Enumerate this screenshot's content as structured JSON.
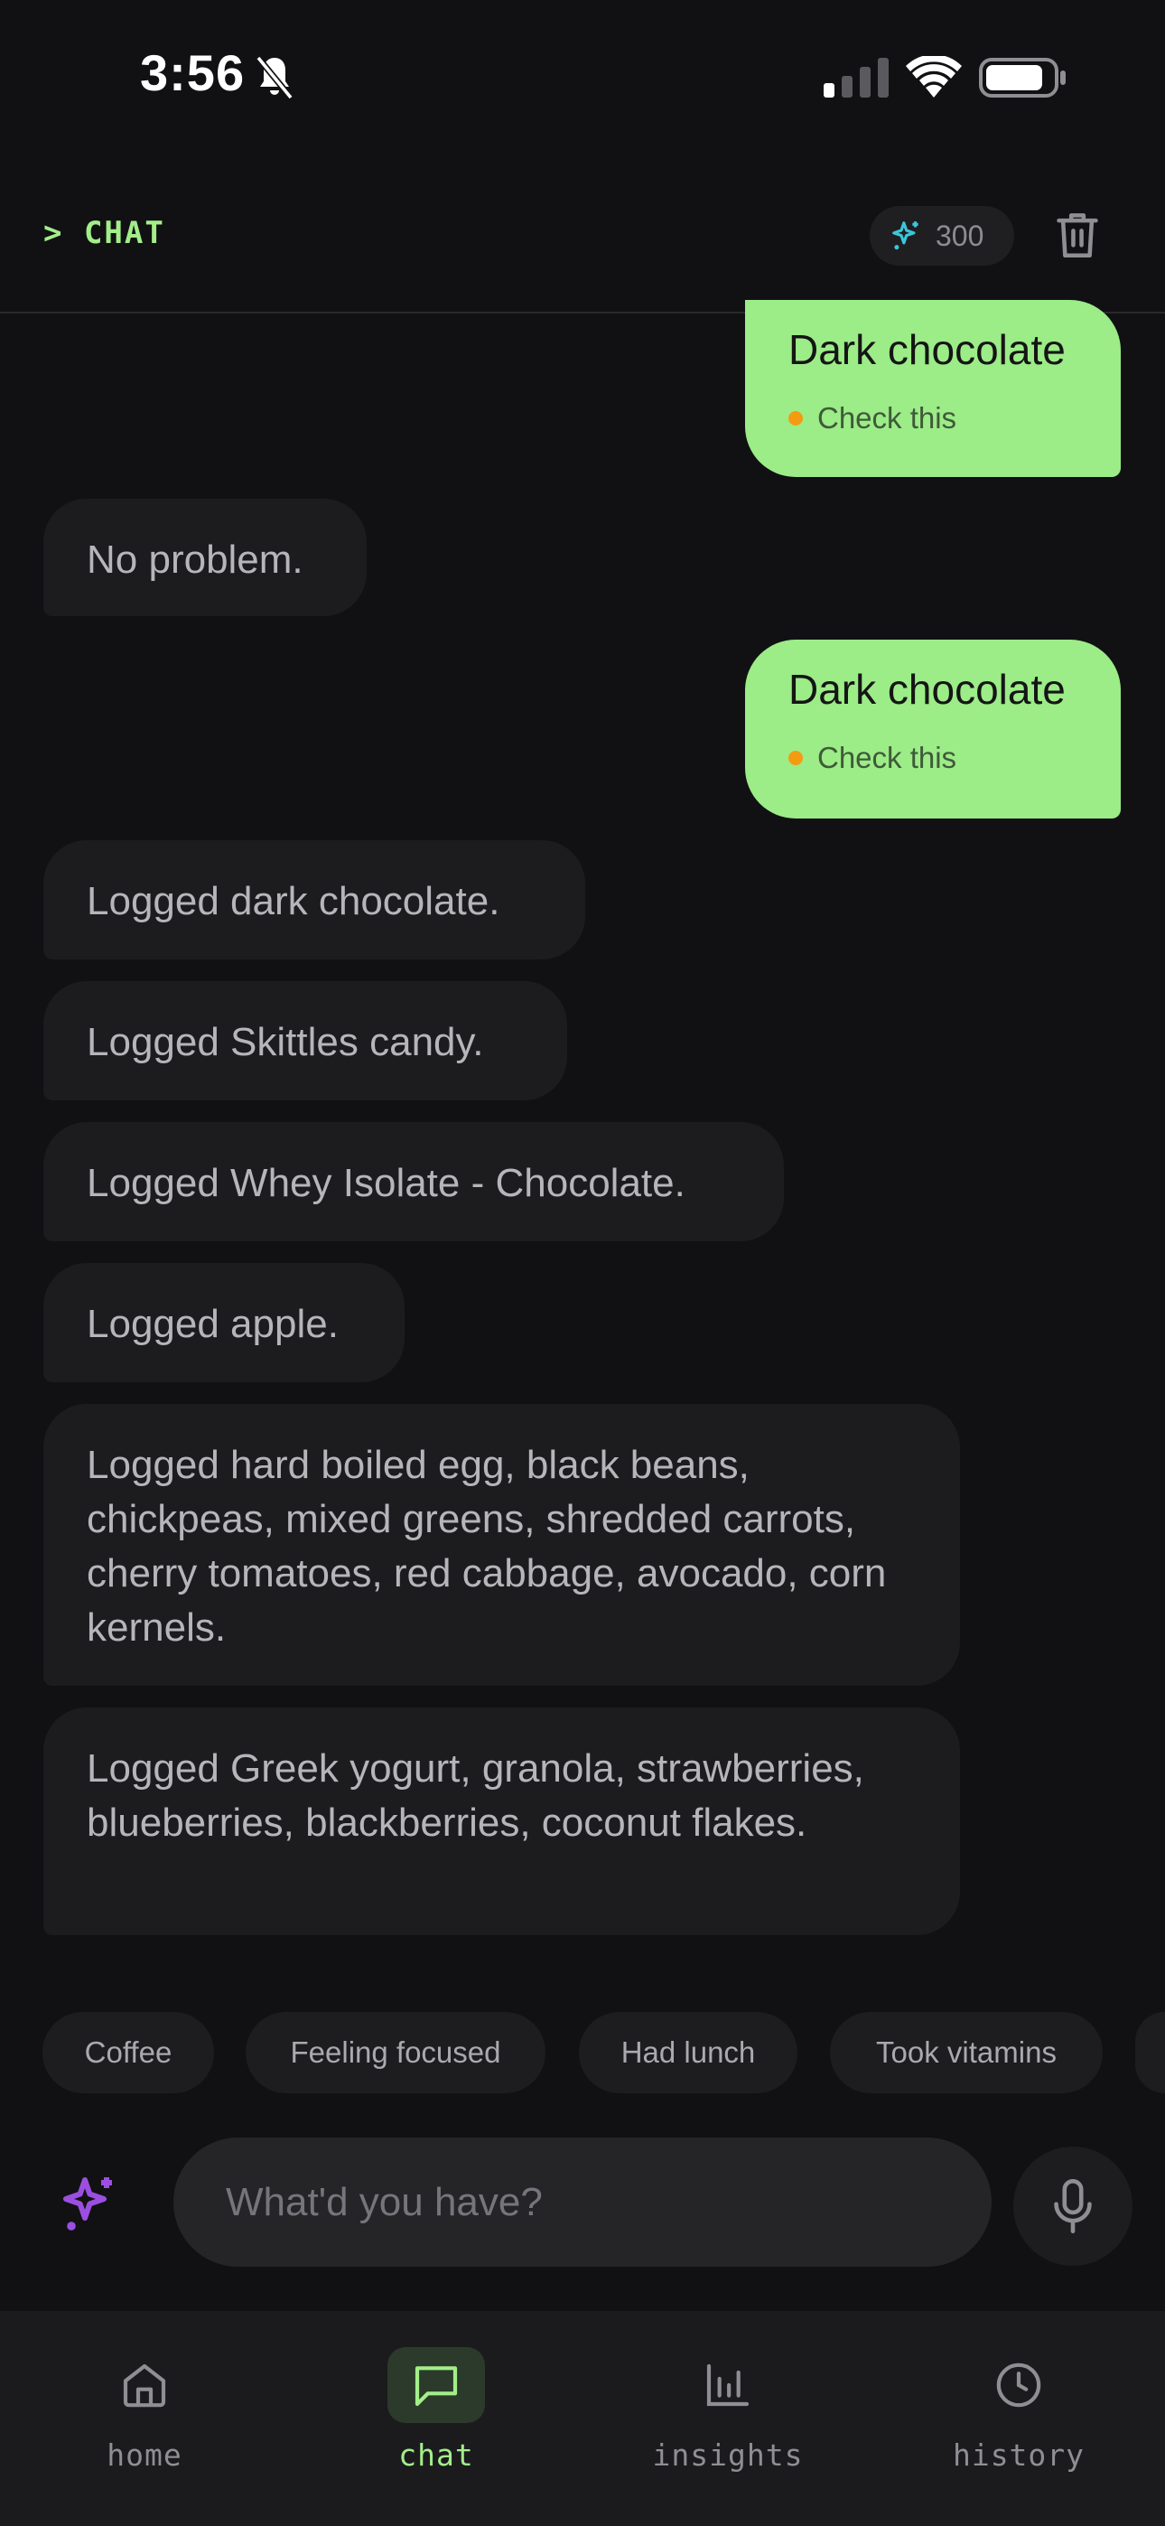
{
  "status_bar": {
    "time": "3:56"
  },
  "header": {
    "title": "> CHAT",
    "credits": "300"
  },
  "messages": [
    {
      "role": "user",
      "text": "Dark chocolate",
      "status": "Check this"
    },
    {
      "role": "assistant",
      "text": "No problem."
    },
    {
      "role": "user",
      "text": "Dark chocolate",
      "status": "Check this"
    },
    {
      "role": "assistant",
      "text": "Logged dark chocolate."
    },
    {
      "role": "assistant",
      "text": "Logged Skittles candy."
    },
    {
      "role": "assistant",
      "text": "Logged Whey Isolate - Chocolate."
    },
    {
      "role": "assistant",
      "text": "Logged apple."
    },
    {
      "role": "assistant",
      "text": "Logged hard boiled egg, black beans, chickpeas, mixed greens, shredded carrots, cherry tomatoes, red cabbage, avocado, corn kernels."
    },
    {
      "role": "assistant",
      "text": "Logged Greek yogurt, granola, strawberries, blueberries, blackberries, coconut flakes."
    }
  ],
  "suggestions": [
    "Coffee",
    "Feeling focused",
    "Had lunch",
    "Took vitamins"
  ],
  "input": {
    "placeholder": "What'd you have?",
    "value": ""
  },
  "nav": [
    {
      "label": "home",
      "icon": "home-icon"
    },
    {
      "label": "chat",
      "icon": "chat-icon",
      "active": true
    },
    {
      "label": "insights",
      "icon": "bar-chart-icon"
    },
    {
      "label": "history",
      "icon": "clock-icon"
    }
  ],
  "colors": {
    "accent": "#a3ee8a",
    "user_bubble": "#9cec88",
    "status_dot": "#f39c12",
    "sparkle_cyan": "#3cc6d8",
    "sparkle_purple": "#9b4fe0"
  }
}
